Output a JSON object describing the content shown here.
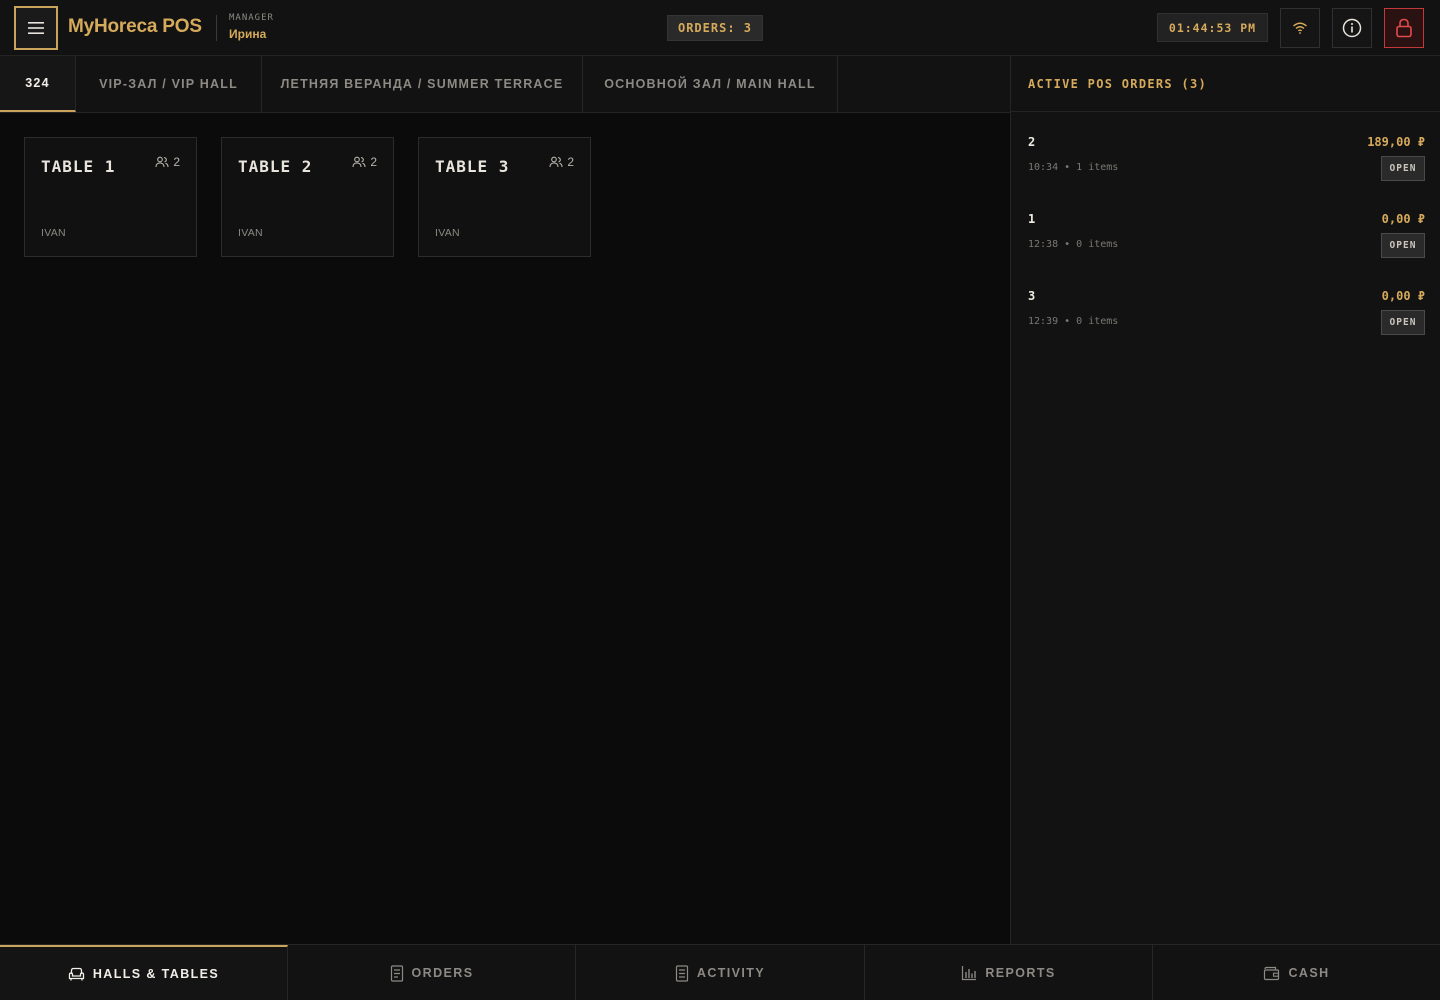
{
  "header": {
    "app_title": "MyHoreca POS",
    "role_label": "MANAGER",
    "user_name": "Ирина",
    "orders_badge": "ORDERS: 3",
    "clock": "01:44:53 PM",
    "icons": {
      "menu": "hamburger-icon",
      "wifi": "wifi-icon",
      "info": "info-icon",
      "lock": "lock-icon"
    }
  },
  "hall_tabs": [
    {
      "label": "324",
      "active": true
    },
    {
      "label": "VIP-ЗАЛ / VIP HALL",
      "active": false
    },
    {
      "label": "ЛЕТНЯЯ ВЕРАНДА / SUMMER TERRACE",
      "active": false
    },
    {
      "label": "ОСНОВНОЙ ЗАЛ / MAIN HALL",
      "active": false
    }
  ],
  "tables": [
    {
      "name": "TABLE 1",
      "seats": "2",
      "waiter": "IVAN"
    },
    {
      "name": "TABLE 2",
      "seats": "2",
      "waiter": "IVAN"
    },
    {
      "name": "TABLE 3",
      "seats": "2",
      "waiter": "IVAN"
    }
  ],
  "orders_panel": {
    "title": "ACTIVE POS ORDERS (3)",
    "orders": [
      {
        "number": "2",
        "total": "189,00 ₽",
        "meta": "10:34 • 1 items",
        "action": "OPEN"
      },
      {
        "number": "1",
        "total": "0,00 ₽",
        "meta": "12:38 • 0 items",
        "action": "OPEN"
      },
      {
        "number": "3",
        "total": "0,00 ₽",
        "meta": "12:39 • 0 items",
        "action": "OPEN"
      }
    ]
  },
  "bottom_nav": [
    {
      "label": "HALLS & TABLES",
      "icon": "armchair-icon",
      "active": true
    },
    {
      "label": "ORDERS",
      "icon": "receipt-icon",
      "active": false
    },
    {
      "label": "ACTIVITY",
      "icon": "document-icon",
      "active": false
    },
    {
      "label": "REPORTS",
      "icon": "bar-chart-icon",
      "active": false
    },
    {
      "label": "CASH",
      "icon": "wallet-icon",
      "active": false
    }
  ],
  "colors": {
    "accent": "#c9a45a",
    "background": "#0b0b0b",
    "panel": "#121212",
    "danger": "#c03a3a"
  }
}
